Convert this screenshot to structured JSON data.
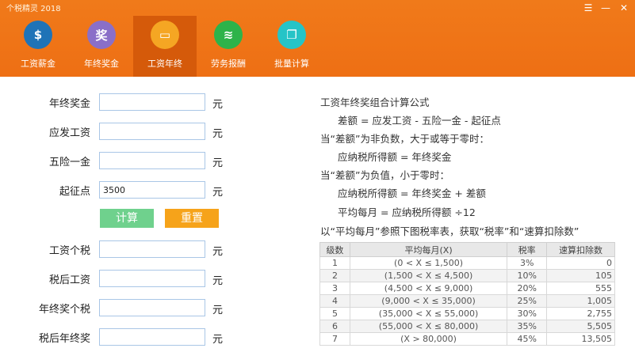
{
  "app": {
    "title": "个税精灵 2018"
  },
  "window": {
    "menu_glyph": "☰",
    "minimize_glyph": "—",
    "close_glyph": "✕"
  },
  "nav": {
    "items": [
      {
        "label": "工资薪金",
        "icon": "money-bag-icon",
        "glyph": "$",
        "color": "#1f73b7",
        "active": false
      },
      {
        "label": "年终奖金",
        "icon": "bonus-icon",
        "glyph": "奖",
        "color": "#8a6fc8",
        "active": false
      },
      {
        "label": "工资年终",
        "icon": "wallet-icon",
        "glyph": "▭",
        "color": "#f5a623",
        "active": true
      },
      {
        "label": "劳务报酬",
        "icon": "coins-icon",
        "glyph": "≋",
        "color": "#2db34a",
        "active": false
      },
      {
        "label": "批量计算",
        "icon": "copy-icon",
        "glyph": "❐",
        "color": "#25c4c7",
        "active": false
      }
    ]
  },
  "form": {
    "unit": "元",
    "bonus_label": "年终奖金",
    "bonus_value": "",
    "gross_label": "应发工资",
    "gross_value": "",
    "insurance_label": "五险一金",
    "insurance_value": "",
    "threshold_label": "起征点",
    "threshold_value": "3500",
    "calc_label": "计算",
    "reset_label": "重置",
    "salary_tax_label": "工资个税",
    "salary_tax_value": "",
    "net_salary_label": "税后工资",
    "net_salary_value": "",
    "bonus_tax_label": "年终奖个税",
    "bonus_tax_value": "",
    "net_bonus_label": "税后年终奖",
    "net_bonus_value": ""
  },
  "formula": {
    "title": "工资年终奖组合计算公式",
    "line1": "差额 =  应发工资  - 五险一金 - 起征点",
    "line2": "当“差额”为非负数，大于或等于零时：",
    "line3": "应纳税所得额 = 年终奖金",
    "line4": "当“差额”为负值，小于零时：",
    "line5": "应纳税所得额 = 年终奖金 + 差额",
    "line6": "平均每月 = 应纳税所得额 ÷12",
    "line7": "以“平均每月”参照下图税率表，获取“税率”和“速算扣除数”"
  },
  "tax_table": {
    "headers": [
      "级数",
      "平均每月(X)",
      "税率",
      "速算扣除数"
    ],
    "rows": [
      [
        "1",
        "(0 < X ≤ 1,500)",
        "3%",
        "0"
      ],
      [
        "2",
        "(1,500 < X ≤ 4,500)",
        "10%",
        "105"
      ],
      [
        "3",
        "(4,500 < X ≤ 9,000)",
        "20%",
        "555"
      ],
      [
        "4",
        "(9,000 < X ≤ 35,000)",
        "25%",
        "1,005"
      ],
      [
        "5",
        "(35,000 < X ≤ 55,000)",
        "30%",
        "2,755"
      ],
      [
        "6",
        "(55,000 < X ≤ 80,000)",
        "35%",
        "5,505"
      ],
      [
        "7",
        "(X > 80,000)",
        "45%",
        "13,505"
      ]
    ]
  },
  "colors": {
    "accent": "#ee6f14",
    "active_tab": "#d55a0a",
    "calc": "#6fd18d",
    "reset": "#f6a31a"
  }
}
